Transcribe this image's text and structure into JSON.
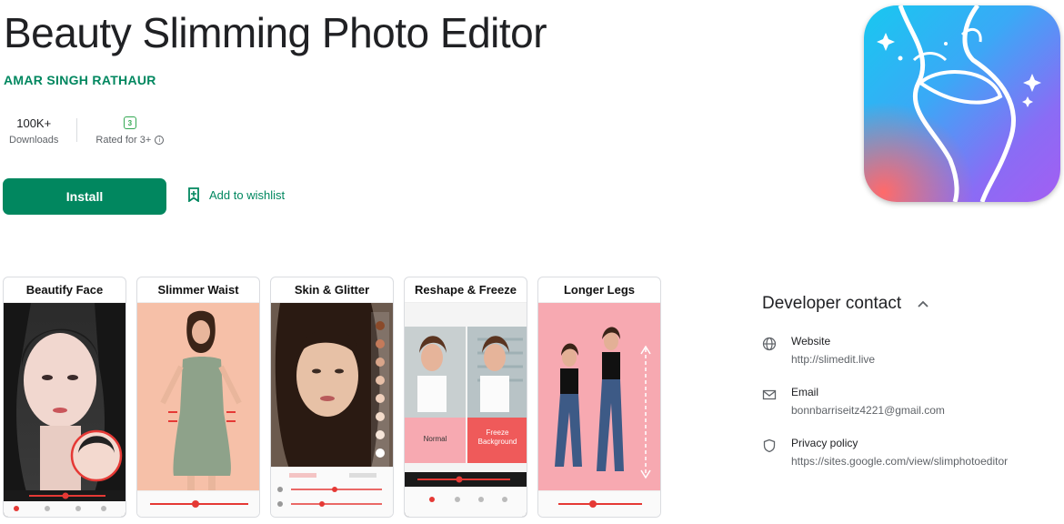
{
  "app": {
    "title": "Beauty Slimming Photo Editor",
    "developer": "AMAR SINGH RATHAUR"
  },
  "stats": {
    "downloads_value": "100K+",
    "downloads_label": "Downloads",
    "rating_badge": "3",
    "rating_label": "Rated for 3+"
  },
  "actions": {
    "install_label": "Install",
    "wishlist_label": "Add to wishlist"
  },
  "screenshots": [
    {
      "title": "Beautify Face"
    },
    {
      "title": "Slimmer Waist"
    },
    {
      "title": "Skin & Glitter"
    },
    {
      "title": "Reshape & Freeze",
      "left_caption": "Normal",
      "right_caption": "Freeze Background"
    },
    {
      "title": "Longer Legs"
    }
  ],
  "developer_contact": {
    "heading": "Developer contact",
    "website_label": "Website",
    "website_value": "http://slimedit.live",
    "email_label": "Email",
    "email_value": "bonnbarriseitz4221@gmail.com",
    "privacy_label": "Privacy policy",
    "privacy_value": "https://sites.google.com/view/slimphotoeditor"
  },
  "colors": {
    "accent": "#01875f",
    "slider_red": "#e53935",
    "pink": "#f7a9b1",
    "peach": "#f6c0a8"
  },
  "icons": [
    "bookmark-plus-icon",
    "info-icon",
    "globe-icon",
    "mail-icon",
    "shield-icon",
    "chevron-up-icon"
  ]
}
